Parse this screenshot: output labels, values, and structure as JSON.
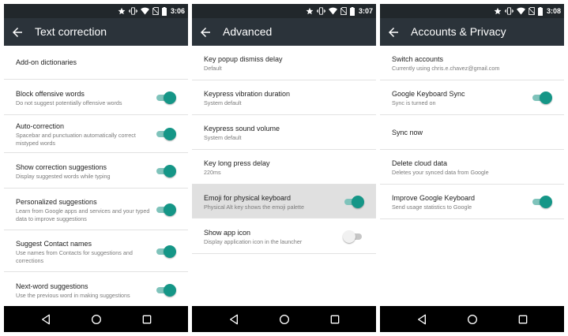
{
  "colors": {
    "status_bar": "#21272b",
    "app_bar": "#2b333a",
    "accent": "#159687",
    "accent_track": "#7fc3bb",
    "divider": "#e2e2e2",
    "selected_row": "#e0e0e0"
  },
  "icons": {
    "status": [
      "star-icon",
      "vibrate-icon",
      "wifi-icon",
      "no-sim-icon",
      "battery-icon"
    ],
    "app_bar": "arrow-back-icon",
    "nav": [
      "nav-back-icon",
      "nav-home-icon",
      "nav-recent-icon"
    ]
  },
  "screens": [
    {
      "time": "3:06",
      "title": "Text correction",
      "items": [
        {
          "title": "Add-on dictionaries",
          "summary": ""
        },
        {
          "title": "Block offensive words",
          "summary": "Do not suggest potentially offensive words",
          "toggle": "on"
        },
        {
          "title": "Auto-correction",
          "summary": "Spacebar and punctuation automatically correct mistyped words",
          "toggle": "on"
        },
        {
          "title": "Show correction suggestions",
          "summary": "Display suggested words while typing",
          "toggle": "on"
        },
        {
          "title": "Personalized suggestions",
          "summary": "Learn from Google apps and services and your typed data to improve suggestions",
          "toggle": "on"
        },
        {
          "title": "Suggest Contact names",
          "summary": "Use names from Contacts for suggestions and corrections",
          "toggle": "on"
        },
        {
          "title": "Next-word suggestions",
          "summary": "Use the previous word in making suggestions",
          "toggle": "on"
        }
      ]
    },
    {
      "time": "3:07",
      "title": "Advanced",
      "items": [
        {
          "title": "Key popup dismiss delay",
          "summary": "Default"
        },
        {
          "title": "Keypress vibration duration",
          "summary": "System default"
        },
        {
          "title": "Keypress sound volume",
          "summary": "System default"
        },
        {
          "title": "Key long press delay",
          "summary": "220ms"
        },
        {
          "title": "Emoji for physical keyboard",
          "summary": "Physical Alt key shows the emoji palette",
          "toggle": "on",
          "selected": true
        },
        {
          "title": "Show app icon",
          "summary": "Display application icon in the launcher",
          "toggle": "off"
        }
      ]
    },
    {
      "time": "3:08",
      "title": "Accounts & Privacy",
      "items": [
        {
          "title": "Switch accounts",
          "summary": "Currently using chris.e.chavez@gmail.com"
        },
        {
          "title": "Google Keyboard Sync",
          "summary": "Sync is turned on",
          "toggle": "on"
        },
        {
          "title": "Sync now",
          "summary": ""
        },
        {
          "title": "Delete cloud data",
          "summary": "Deletes your synced data from Google"
        },
        {
          "title": "Improve Google Keyboard",
          "summary": "Send usage statistics to Google",
          "toggle": "on"
        }
      ]
    }
  ]
}
